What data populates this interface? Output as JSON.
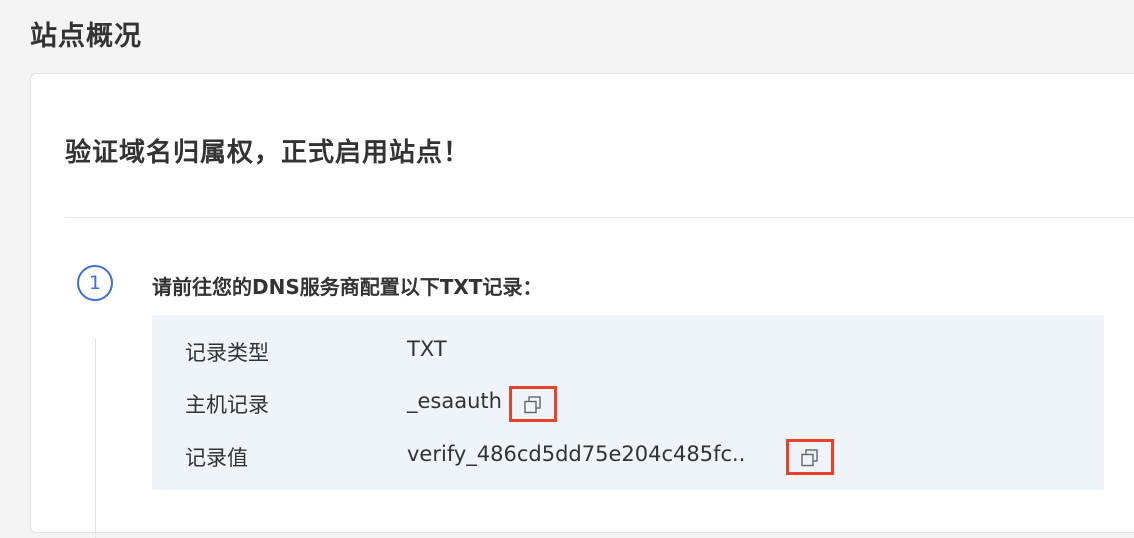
{
  "page": {
    "title": "站点概况"
  },
  "card": {
    "heading": "验证域名归属权，正式启用站点！"
  },
  "step": {
    "number": "1",
    "title": "请前往您的DNS服务商配置以下TXT记录："
  },
  "records": [
    {
      "label": "记录类型",
      "value": "TXT"
    },
    {
      "label": "主机记录",
      "value": "_esaauth",
      "copy_icon": "copy-icon"
    },
    {
      "label": "记录值",
      "value": "verify_486cd5dd75e204c485fc..",
      "copy_icon": "copy-icon"
    }
  ],
  "colors": {
    "accent": "#3e6fd8",
    "highlight_border": "#e8412c",
    "record_background": "#eef4fa"
  }
}
